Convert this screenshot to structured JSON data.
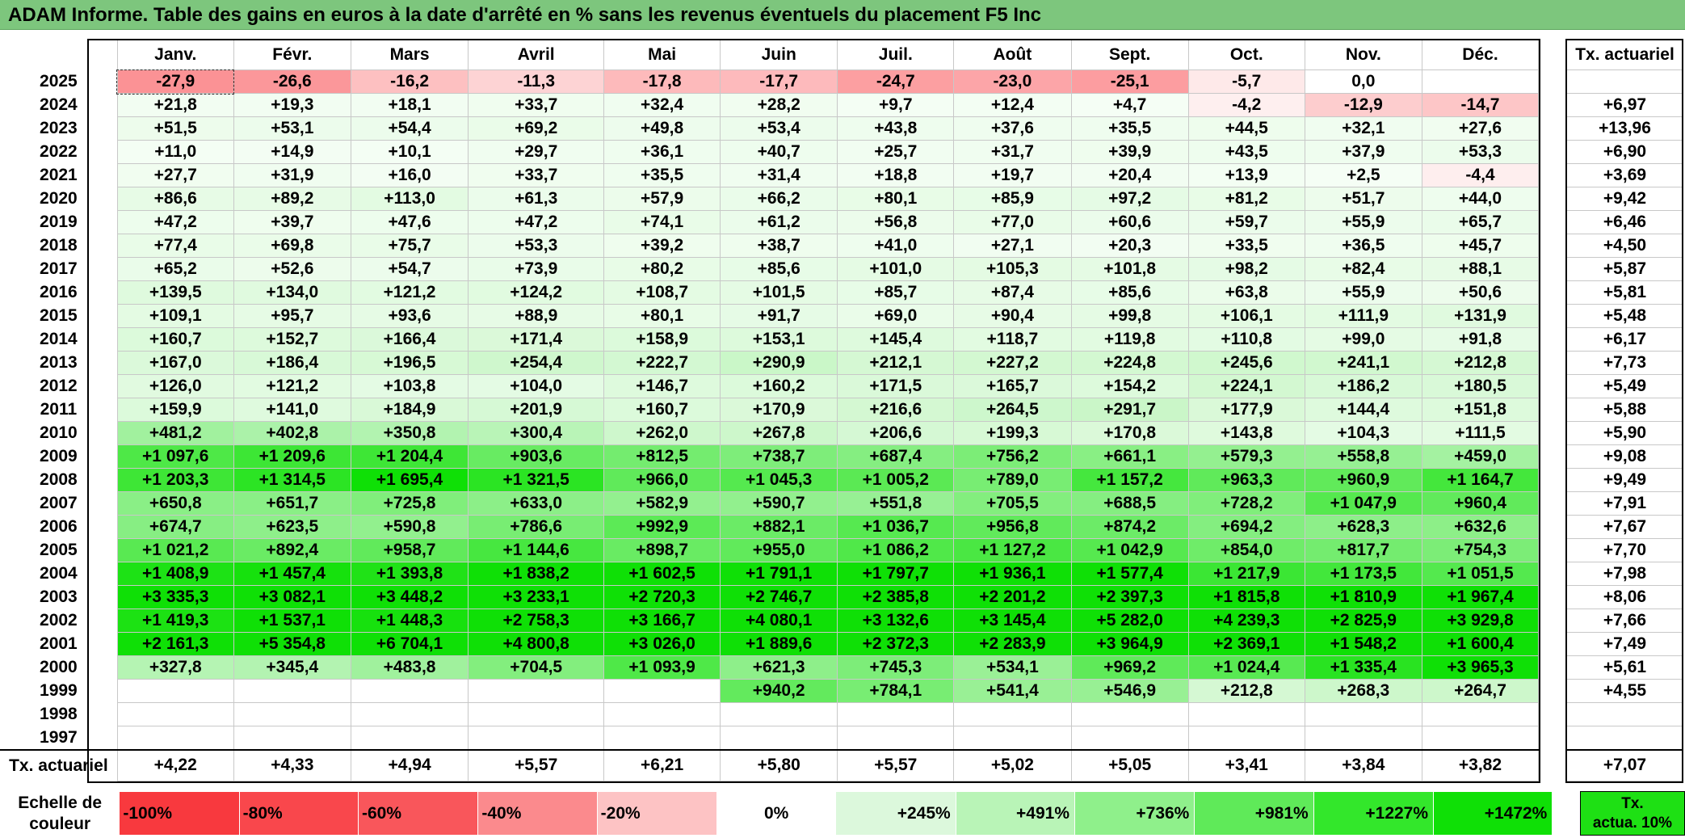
{
  "title": "ADAM Informe. Table des gains en euros à la date d'arrêté en % sans les revenus éventuels du placement F5 Inc",
  "months": [
    "Janv.",
    "Févr.",
    "Mars",
    "Avril",
    "Mai",
    "Juin",
    "Juil.",
    "Août",
    "Sept.",
    "Oct.",
    "Nov.",
    "Déc."
  ],
  "side_header": "Tx. actuariel",
  "rows": [
    {
      "year": "2025",
      "values": [
        "-27,9",
        "-26,6",
        "-16,2",
        "-11,3",
        "-17,8",
        "-17,7",
        "-24,7",
        "-23,0",
        "-25,1",
        "-5,7",
        "0,0",
        ""
      ],
      "rate": ""
    },
    {
      "year": "2024",
      "values": [
        "+21,8",
        "+19,3",
        "+18,1",
        "+33,7",
        "+32,4",
        "+28,2",
        "+9,7",
        "+12,4",
        "+4,7",
        "-4,2",
        "-12,9",
        "-14,7"
      ],
      "rate": "+6,97"
    },
    {
      "year": "2023",
      "values": [
        "+51,5",
        "+53,1",
        "+54,4",
        "+69,2",
        "+49,8",
        "+53,4",
        "+43,8",
        "+37,6",
        "+35,5",
        "+44,5",
        "+32,1",
        "+27,6"
      ],
      "rate": "+13,96"
    },
    {
      "year": "2022",
      "values": [
        "+11,0",
        "+14,9",
        "+10,1",
        "+29,7",
        "+36,1",
        "+40,7",
        "+25,7",
        "+31,7",
        "+39,9",
        "+43,5",
        "+37,9",
        "+53,3"
      ],
      "rate": "+6,90"
    },
    {
      "year": "2021",
      "values": [
        "+27,7",
        "+31,9",
        "+16,0",
        "+33,7",
        "+35,5",
        "+31,4",
        "+18,8",
        "+19,7",
        "+20,4",
        "+13,9",
        "+2,5",
        "-4,4"
      ],
      "rate": "+3,69"
    },
    {
      "year": "2020",
      "values": [
        "+86,6",
        "+89,2",
        "+113,0",
        "+61,3",
        "+57,9",
        "+66,2",
        "+80,1",
        "+85,9",
        "+97,2",
        "+81,2",
        "+51,7",
        "+44,0"
      ],
      "rate": "+9,42"
    },
    {
      "year": "2019",
      "values": [
        "+47,2",
        "+39,7",
        "+47,6",
        "+47,2",
        "+74,1",
        "+61,2",
        "+56,8",
        "+77,0",
        "+60,6",
        "+59,7",
        "+55,9",
        "+65,7"
      ],
      "rate": "+6,46"
    },
    {
      "year": "2018",
      "values": [
        "+77,4",
        "+69,8",
        "+75,7",
        "+53,3",
        "+39,2",
        "+38,7",
        "+41,0",
        "+27,1",
        "+20,3",
        "+33,5",
        "+36,5",
        "+45,7"
      ],
      "rate": "+4,50"
    },
    {
      "year": "2017",
      "values": [
        "+65,2",
        "+52,6",
        "+54,7",
        "+73,9",
        "+80,2",
        "+85,6",
        "+101,0",
        "+105,3",
        "+101,8",
        "+98,2",
        "+82,4",
        "+88,1"
      ],
      "rate": "+5,87"
    },
    {
      "year": "2016",
      "values": [
        "+139,5",
        "+134,0",
        "+121,2",
        "+124,2",
        "+108,7",
        "+101,5",
        "+85,7",
        "+87,4",
        "+85,6",
        "+63,8",
        "+55,9",
        "+50,6"
      ],
      "rate": "+5,81"
    },
    {
      "year": "2015",
      "values": [
        "+109,1",
        "+95,7",
        "+93,6",
        "+88,9",
        "+80,1",
        "+91,7",
        "+69,0",
        "+90,4",
        "+99,8",
        "+106,1",
        "+111,9",
        "+131,9"
      ],
      "rate": "+5,48"
    },
    {
      "year": "2014",
      "values": [
        "+160,7",
        "+152,7",
        "+166,4",
        "+171,4",
        "+158,9",
        "+153,1",
        "+145,4",
        "+118,7",
        "+119,8",
        "+110,8",
        "+99,0",
        "+91,8"
      ],
      "rate": "+6,17"
    },
    {
      "year": "2013",
      "values": [
        "+167,0",
        "+186,4",
        "+196,5",
        "+254,4",
        "+222,7",
        "+290,9",
        "+212,1",
        "+227,2",
        "+224,8",
        "+245,6",
        "+241,1",
        "+212,8"
      ],
      "rate": "+7,73"
    },
    {
      "year": "2012",
      "values": [
        "+126,0",
        "+121,2",
        "+103,8",
        "+104,0",
        "+146,7",
        "+160,2",
        "+171,5",
        "+165,7",
        "+154,2",
        "+224,1",
        "+186,2",
        "+180,5"
      ],
      "rate": "+5,49"
    },
    {
      "year": "2011",
      "values": [
        "+159,9",
        "+141,0",
        "+184,9",
        "+201,9",
        "+160,7",
        "+170,9",
        "+216,6",
        "+264,5",
        "+291,7",
        "+177,9",
        "+144,4",
        "+151,8"
      ],
      "rate": "+5,88"
    },
    {
      "year": "2010",
      "values": [
        "+481,2",
        "+402,8",
        "+350,8",
        "+300,4",
        "+262,0",
        "+267,8",
        "+206,6",
        "+199,3",
        "+170,8",
        "+143,8",
        "+104,3",
        "+111,5"
      ],
      "rate": "+5,90"
    },
    {
      "year": "2009",
      "values": [
        "+1 097,6",
        "+1 209,6",
        "+1 204,4",
        "+903,6",
        "+812,5",
        "+738,7",
        "+687,4",
        "+756,2",
        "+661,1",
        "+579,3",
        "+558,8",
        "+459,0"
      ],
      "rate": "+9,08"
    },
    {
      "year": "2008",
      "values": [
        "+1 203,3",
        "+1 314,5",
        "+1 695,4",
        "+1 321,5",
        "+966,0",
        "+1 045,3",
        "+1 005,2",
        "+789,0",
        "+1 157,2",
        "+963,3",
        "+960,9",
        "+1 164,7"
      ],
      "rate": "+9,49"
    },
    {
      "year": "2007",
      "values": [
        "+650,8",
        "+651,7",
        "+725,8",
        "+633,0",
        "+582,9",
        "+590,7",
        "+551,8",
        "+705,5",
        "+688,5",
        "+728,2",
        "+1 047,9",
        "+960,4"
      ],
      "rate": "+7,91"
    },
    {
      "year": "2006",
      "values": [
        "+674,7",
        "+623,5",
        "+590,8",
        "+786,6",
        "+992,9",
        "+882,1",
        "+1 036,7",
        "+956,8",
        "+874,2",
        "+694,2",
        "+628,3",
        "+632,6"
      ],
      "rate": "+7,67"
    },
    {
      "year": "2005",
      "values": [
        "+1 021,2",
        "+892,4",
        "+958,7",
        "+1 144,6",
        "+898,7",
        "+955,0",
        "+1 086,2",
        "+1 127,2",
        "+1 042,9",
        "+854,0",
        "+817,7",
        "+754,3"
      ],
      "rate": "+7,70"
    },
    {
      "year": "2004",
      "values": [
        "+1 408,9",
        "+1 457,4",
        "+1 393,8",
        "+1 838,2",
        "+1 602,5",
        "+1 791,1",
        "+1 797,7",
        "+1 936,1",
        "+1 577,4",
        "+1 217,9",
        "+1 173,5",
        "+1 051,5"
      ],
      "rate": "+7,98"
    },
    {
      "year": "2003",
      "values": [
        "+3 335,3",
        "+3 082,1",
        "+3 448,2",
        "+3 233,1",
        "+2 720,3",
        "+2 746,7",
        "+2 385,8",
        "+2 201,2",
        "+2 397,3",
        "+1 815,8",
        "+1 810,9",
        "+1 967,4"
      ],
      "rate": "+8,06"
    },
    {
      "year": "2002",
      "values": [
        "+1 419,3",
        "+1 537,1",
        "+1 448,3",
        "+2 758,3",
        "+3 166,7",
        "+4 080,1",
        "+3 132,6",
        "+3 145,4",
        "+5 282,0",
        "+4 239,3",
        "+2 825,9",
        "+3 929,8"
      ],
      "rate": "+7,66"
    },
    {
      "year": "2001",
      "values": [
        "+2 161,3",
        "+5 354,8",
        "+6 704,1",
        "+4 800,8",
        "+3 026,0",
        "+1 889,6",
        "+2 372,3",
        "+2 283,9",
        "+3 964,9",
        "+2 369,1",
        "+1 548,2",
        "+1 600,4"
      ],
      "rate": "+7,49"
    },
    {
      "year": "2000",
      "values": [
        "+327,8",
        "+345,4",
        "+483,8",
        "+704,5",
        "+1 093,9",
        "+621,3",
        "+745,3",
        "+534,1",
        "+969,2",
        "+1 024,4",
        "+1 335,4",
        "+3 965,3"
      ],
      "rate": "+5,61"
    },
    {
      "year": "1999",
      "values": [
        "",
        "",
        "",
        "",
        "",
        "+940,2",
        "+784,1",
        "+541,4",
        "+546,9",
        "+212,8",
        "+268,3",
        "+264,7"
      ],
      "rate": "+4,55"
    },
    {
      "year": "1998",
      "values": [
        "",
        "",
        "",
        "",
        "",
        "",
        "",
        "",
        "",
        "",
        "",
        ""
      ],
      "rate": ""
    },
    {
      "year": "1997",
      "values": [
        "",
        "",
        "",
        "",
        "",
        "",
        "",
        "",
        "",
        "",
        "",
        ""
      ],
      "rate": ""
    }
  ],
  "totals": {
    "label": "Tx. actuariel",
    "values": [
      "+4,22",
      "+4,33",
      "+4,94",
      "+5,57",
      "+6,21",
      "+5,80",
      "+5,57",
      "+5,02",
      "+5,05",
      "+3,41",
      "+3,84",
      "+3,82"
    ],
    "overall": "+7,07"
  },
  "scale": {
    "label_line1": "Echelle de",
    "label_line2": "couleur",
    "steps": [
      {
        "label": "-100%",
        "color": "#f8393e"
      },
      {
        "label": "-80%",
        "color": "#f9474c"
      },
      {
        "label": "-60%",
        "color": "#f9565b"
      },
      {
        "label": "-40%",
        "color": "#fb8a8d"
      },
      {
        "label": "-20%",
        "color": "#fdc3c4"
      },
      {
        "label": "0%",
        "color": "#ffffff"
      },
      {
        "label": "+245%",
        "color": "#dcf8dc"
      },
      {
        "label": "+491%",
        "color": "#b9f4b7"
      },
      {
        "label": "+736%",
        "color": "#8ff08b"
      },
      {
        "label": "+981%",
        "color": "#5fea59"
      },
      {
        "label": "+1227%",
        "color": "#33e72b"
      },
      {
        "label": "+1472%",
        "color": "#0fe006"
      }
    ],
    "side_line1": "Tx.",
    "side_line2": "actua. 10%",
    "side_color": "#1ee014"
  },
  "colors": {
    "title_bar": "#7dc67d"
  }
}
